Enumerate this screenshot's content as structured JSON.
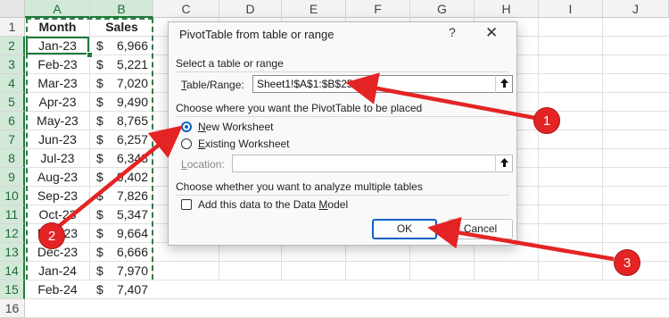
{
  "columns": [
    "A",
    "B",
    "C",
    "D",
    "E",
    "F",
    "G",
    "H",
    "I",
    "J"
  ],
  "rows": [
    "1",
    "2",
    "3",
    "4",
    "5",
    "6",
    "7",
    "8",
    "9",
    "10",
    "11",
    "12",
    "13",
    "14",
    "15",
    "16"
  ],
  "table": {
    "headers": {
      "month": "Month",
      "sales": "Sales"
    },
    "currency": "$",
    "data": [
      {
        "month": "Jan-23",
        "sales": "6,966"
      },
      {
        "month": "Feb-23",
        "sales": "5,221"
      },
      {
        "month": "Mar-23",
        "sales": "7,020"
      },
      {
        "month": "Apr-23",
        "sales": "9,490"
      },
      {
        "month": "May-23",
        "sales": "8,765"
      },
      {
        "month": "Jun-23",
        "sales": "6,257"
      },
      {
        "month": "Jul-23",
        "sales": "6,343"
      },
      {
        "month": "Aug-23",
        "sales": "9,402"
      },
      {
        "month": "Sep-23",
        "sales": "7,826"
      },
      {
        "month": "Oct-23",
        "sales": "5,347"
      },
      {
        "month": "Nov-23",
        "sales": "9,664"
      },
      {
        "month": "Dec-23",
        "sales": "6,666"
      },
      {
        "month": "Jan-24",
        "sales": "7,970"
      },
      {
        "month": "Feb-24",
        "sales": "7,407"
      }
    ]
  },
  "dialog": {
    "title": "PivotTable from table or range",
    "help": "?",
    "close": "✕",
    "section1": "Select a table or range",
    "table_range_label": "Table/Range:",
    "table_range_value": "Sheet1!$A$1:$B$25",
    "section2": "Choose where you want the PivotTable to be placed",
    "new_worksheet": "New Worksheet",
    "existing_worksheet": "Existing Worksheet",
    "location_label": "Location:",
    "location_value": "",
    "section3": "Choose whether you want to analyze multiple tables",
    "data_model_label": "Add this data to the Data Model",
    "ok": "OK",
    "cancel": "Cancel"
  },
  "callouts": [
    "1",
    "2",
    "3"
  ],
  "colors": {
    "annotation": "#e42424",
    "accent": "#0b62c4",
    "excel_green": "#1f7a3c"
  }
}
